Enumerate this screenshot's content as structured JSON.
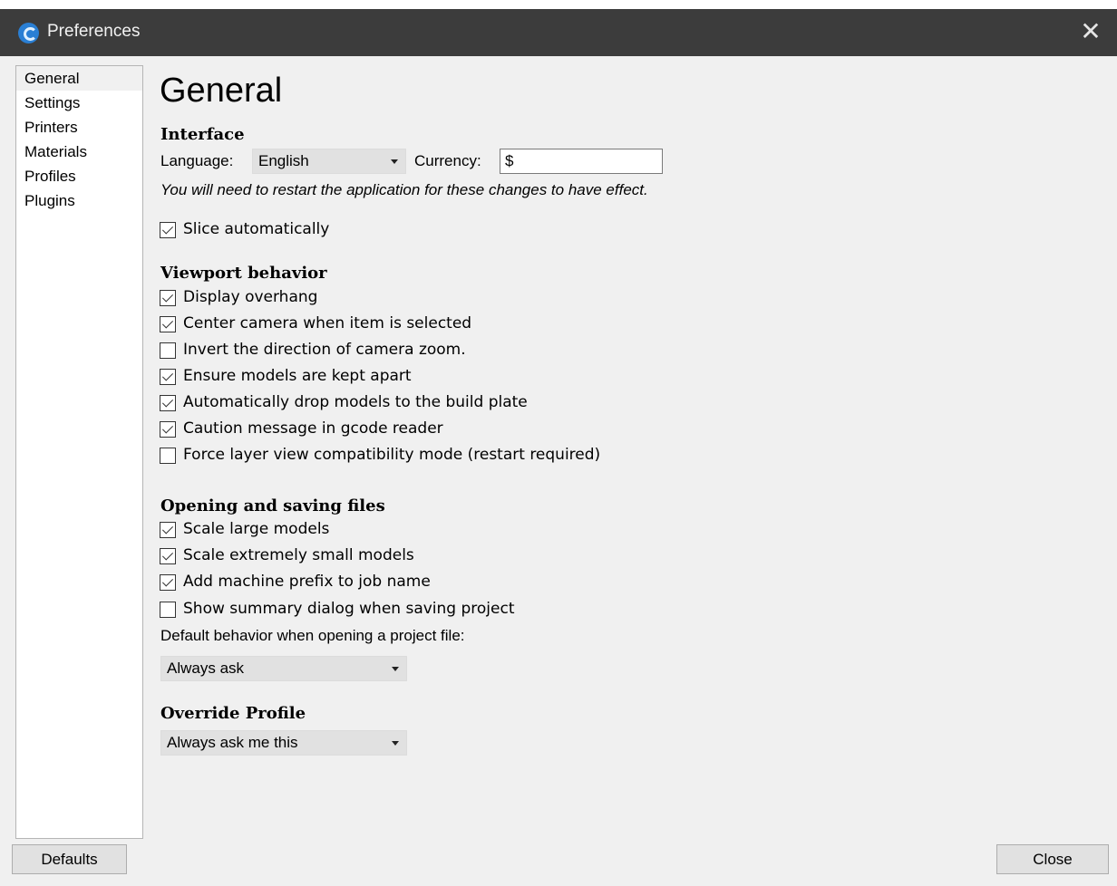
{
  "window": {
    "title": "Preferences",
    "close_glyph": "✕",
    "icon": "app-logo-icon"
  },
  "sidebar": {
    "items": [
      {
        "label": "General",
        "selected": true
      },
      {
        "label": "Settings"
      },
      {
        "label": "Printers"
      },
      {
        "label": "Materials"
      },
      {
        "label": "Profiles"
      },
      {
        "label": "Plugins"
      }
    ]
  },
  "page": {
    "title": "General",
    "interface": {
      "heading": "Interface",
      "language_label": "Language:",
      "language_value": "English",
      "currency_label": "Currency:",
      "currency_value": "$",
      "restart_note": "You will need to restart the application for these changes to have effect."
    },
    "slice_automatically": {
      "label": "Slice automatically",
      "checked": true
    },
    "viewport": {
      "heading": "Viewport behavior",
      "options": [
        {
          "label": "Display overhang",
          "checked": true
        },
        {
          "label": "Center camera when item is selected",
          "checked": true
        },
        {
          "label": "Invert the direction of camera zoom.",
          "checked": false
        },
        {
          "label": "Ensure models are kept apart",
          "checked": true
        },
        {
          "label": "Automatically drop models to the build plate",
          "checked": true
        },
        {
          "label": "Caution message in gcode reader",
          "checked": true
        },
        {
          "label": "Force layer view compatibility mode (restart required)",
          "checked": false
        }
      ]
    },
    "files": {
      "heading": "Opening and saving files",
      "options": [
        {
          "label": "Scale large models",
          "checked": true
        },
        {
          "label": "Scale extremely small models",
          "checked": true
        },
        {
          "label": "Add machine prefix to job name",
          "checked": true
        },
        {
          "label": "Show summary dialog when saving project",
          "checked": false
        }
      ],
      "default_behavior_label": "Default behavior when opening a project file:",
      "default_behavior_value": "Always ask"
    },
    "override": {
      "heading": "Override Profile",
      "value": "Always ask me this"
    }
  },
  "footer": {
    "defaults_label": "Defaults",
    "close_label": "Close"
  }
}
